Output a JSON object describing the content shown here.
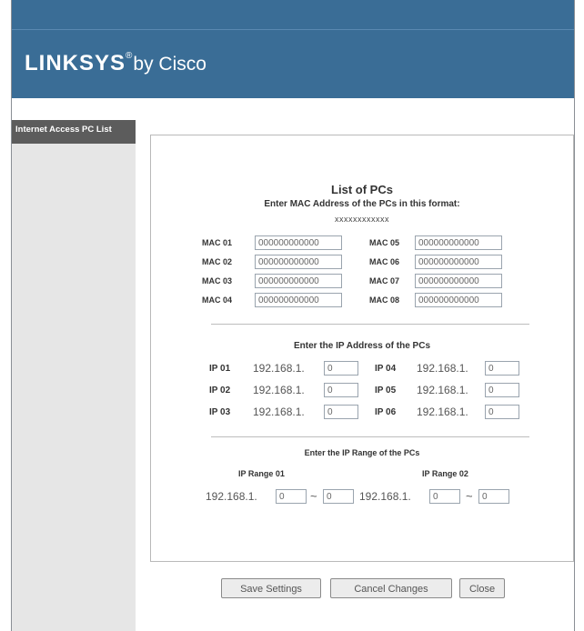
{
  "brand": {
    "name": "LINKSYS",
    "reg": "®",
    "suffix": "by Cisco"
  },
  "sidebar": {
    "heading": "Internet Access PC List"
  },
  "form": {
    "title": "List of PCs",
    "mac_instruction": "Enter MAC Address of the PCs in this format:",
    "mac_format": "xxxxxxxxxxxx",
    "mac_fields": [
      {
        "label": "MAC 01",
        "value": "000000000000"
      },
      {
        "label": "MAC 02",
        "value": "000000000000"
      },
      {
        "label": "MAC 03",
        "value": "000000000000"
      },
      {
        "label": "MAC 04",
        "value": "000000000000"
      },
      {
        "label": "MAC 05",
        "value": "000000000000"
      },
      {
        "label": "MAC 06",
        "value": "000000000000"
      },
      {
        "label": "MAC 07",
        "value": "000000000000"
      },
      {
        "label": "MAC 08",
        "value": "000000000000"
      }
    ],
    "ip_instruction": "Enter the IP Address of the PCs",
    "ip_prefix": "192.168.1.",
    "ip_fields": [
      {
        "label": "IP 01",
        "value": "0"
      },
      {
        "label": "IP 02",
        "value": "0"
      },
      {
        "label": "IP 03",
        "value": "0"
      },
      {
        "label": "IP 04",
        "value": "0"
      },
      {
        "label": "IP 05",
        "value": "0"
      },
      {
        "label": "IP 06",
        "value": "0"
      }
    ],
    "range_instruction": "Enter the IP Range of the PCs",
    "ranges": [
      {
        "label": "IP Range 01",
        "prefix": "192.168.1.",
        "start": "0",
        "separator": "~",
        "end": "0"
      },
      {
        "label": "IP Range 02",
        "prefix": "192.168.1.",
        "start": "0",
        "separator": "~",
        "end": "0"
      }
    ]
  },
  "buttons": {
    "save": "Save Settings",
    "cancel": "Cancel Changes",
    "close": "Close"
  }
}
